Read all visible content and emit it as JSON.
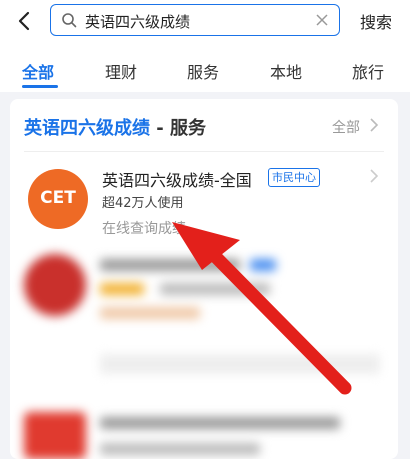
{
  "search": {
    "query": "英语四六级成绩",
    "button_label": "搜索"
  },
  "tabs": [
    {
      "label": "全部",
      "active": true
    },
    {
      "label": "理财",
      "active": false
    },
    {
      "label": "服务",
      "active": false
    },
    {
      "label": "本地",
      "active": false
    },
    {
      "label": "旅行",
      "active": false
    }
  ],
  "section": {
    "title_keyword": "英语四六级成绩",
    "title_rest": " - 服务",
    "more_label": "全部"
  },
  "result": {
    "logo_text": "CET",
    "title": "英语四六级成绩-全国",
    "tag": "市民中心",
    "users": "超42万人使用",
    "description": "在线查询成绩"
  },
  "colors": {
    "accent": "#1a73e8",
    "logo_bg": "#ee6a25",
    "arrow": "#e3201b"
  }
}
